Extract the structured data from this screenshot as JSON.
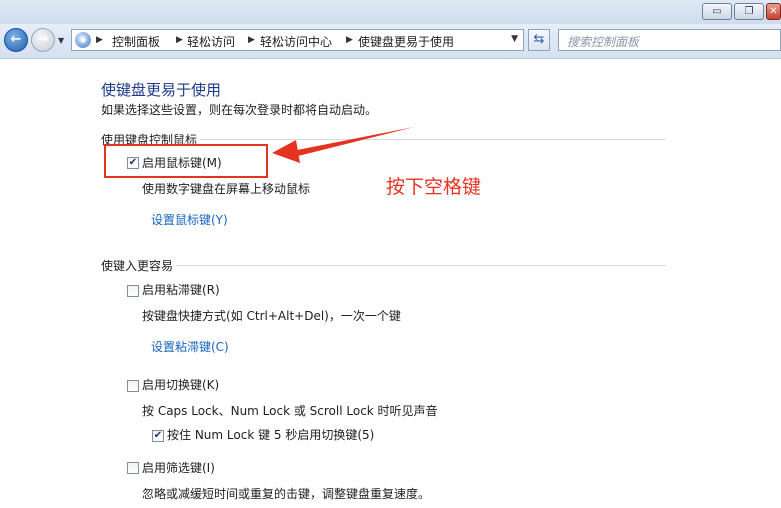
{
  "window": {
    "minimize_glyph": "▭",
    "restore_glyph": "❐",
    "close_glyph": "✕"
  },
  "nav": {
    "back_icon": "back-arrow-icon",
    "forward_icon": "forward-arrow-icon",
    "breadcrumbs": [
      "控制面板",
      "轻松访问",
      "轻松访问中心",
      "使键盘更易于使用"
    ],
    "search_placeholder": "搜索控制面板"
  },
  "page": {
    "title": "使键盘更易于使用",
    "description": "如果选择这些设置，则在每次登录时都将自动启动。",
    "sections": [
      {
        "heading": "使用键盘控制鼠标",
        "options": [
          {
            "label": "启用鼠标键(M)",
            "checked": true,
            "note": "使用数字键盘在屏幕上移动鼠标",
            "link": "设置鼠标键(Y)"
          }
        ]
      },
      {
        "heading": "使键入更容易",
        "options": [
          {
            "label": "启用粘滞键(R)",
            "checked": false,
            "note": "按键盘快捷方式(如 Ctrl+Alt+Del)，一次一个键",
            "link": "设置粘滞键(C)"
          },
          {
            "label": "启用切换键(K)",
            "checked": false,
            "note": "按 Caps Lock、Num Lock 或 Scroll Lock 时听见声音",
            "sub_option": {
              "label": "按住 Num Lock 键 5 秒启用切换键(5)",
              "checked": true
            }
          },
          {
            "label": "启用筛选键(I)",
            "checked": false,
            "note": "忽略或减缓短时间或重复的击键，调整键盘重复速度。"
          }
        ]
      }
    ]
  },
  "annotation": {
    "text": "按下空格键",
    "color": "#e53322"
  }
}
